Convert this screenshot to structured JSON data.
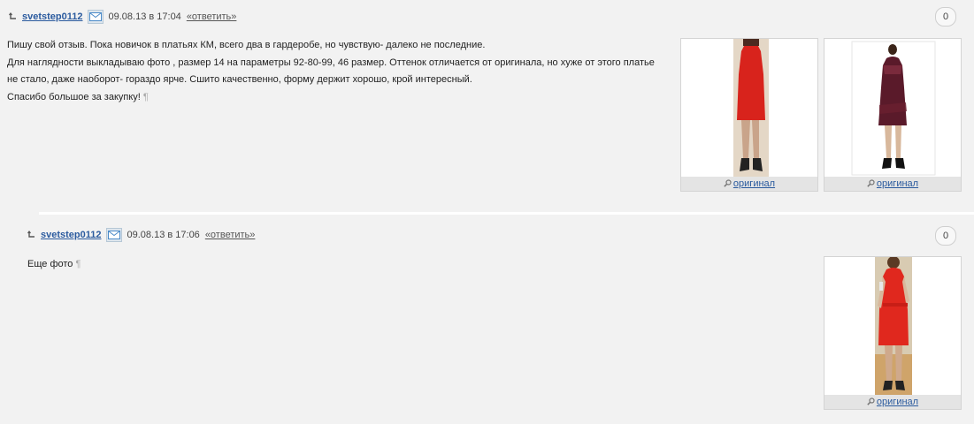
{
  "comments": [
    {
      "author": "svetstep0112",
      "date": "09.08.13 в 17:04",
      "reply_label": "«ответить»",
      "count": "0",
      "lines": [
        "Пишу свой отзыв. Пока новичок в платьях КМ, всего два в гардеробе, но чувствую- далеко не последние.",
        "Для наглядности выкладываю фото , размер 14 на параметры 92-80-99, 46 размер. Оттенок отличается от оригинала, но хуже от этого платье",
        "не стало, даже наоборот- гораздо ярче. Сшито качественно, форму держит хорошо, крой интересный.",
        "Спасибо большое за закупку!"
      ],
      "pilcrow": "¶",
      "photos": [
        {
          "caption": "оригинал",
          "dress_color": "#d8231c"
        },
        {
          "caption": "оригинал",
          "dress_color": "#5a1a2a"
        }
      ]
    },
    {
      "author": "svetstep0112",
      "date": "09.08.13 в 17:06",
      "reply_label": "«ответить»",
      "count": "0",
      "lines": [
        "Еще фото"
      ],
      "pilcrow": "¶",
      "photos": [
        {
          "caption": "оригинал",
          "dress_color": "#e0281e"
        }
      ]
    }
  ],
  "colors": {
    "link": "#2a5a9e",
    "background": "#f2f2f2"
  },
  "icons": {
    "reply_arrow": "reply-arrow-icon",
    "mail": "mail-icon",
    "zoom": "magnifier-icon"
  }
}
